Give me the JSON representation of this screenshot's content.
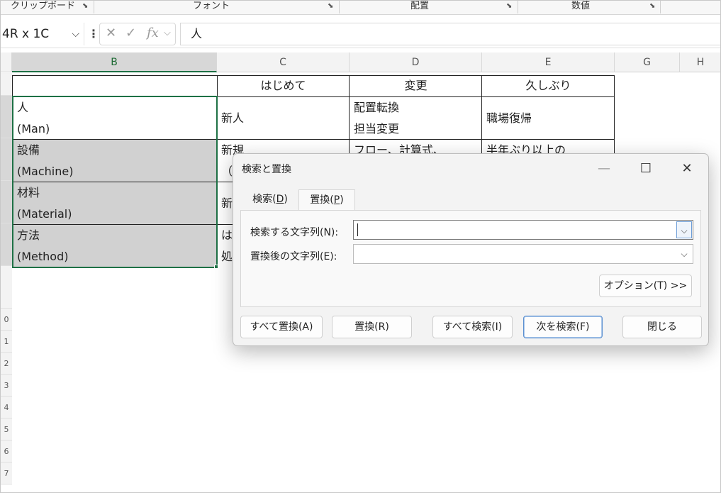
{
  "ribbon": {
    "groups": [
      {
        "label": "クリップボード"
      },
      {
        "label": "フォント"
      },
      {
        "label": "配置"
      },
      {
        "label": "数値"
      }
    ]
  },
  "formula_bar": {
    "name_box": "4R x 1C",
    "cancel_glyph": "✕",
    "enter_glyph": "✓",
    "fx_label": "fx",
    "content": "人"
  },
  "columns": [
    "B",
    "C",
    "D",
    "E",
    "G",
    "H"
  ],
  "row_numbers": [
    "0",
    "1",
    "2",
    "3",
    "4",
    "5",
    "6",
    "7"
  ],
  "table": {
    "headers": [
      "",
      "はじめて",
      "変更",
      "久しぶり"
    ],
    "rows": [
      {
        "b1": "人",
        "b2": "(Man)",
        "c1": "新人",
        "d1": "配置転換",
        "d2": "担当変更",
        "e1": "職場復帰"
      },
      {
        "b1": "設備",
        "b2": "(Machine)",
        "c1": "新規",
        "c2": "（",
        "d1": "フロー、計算式、",
        "e1": "半年ぶり以上の"
      },
      {
        "b1": "材料",
        "b2": "(Material)",
        "c1": "新"
      },
      {
        "b1": "方法",
        "b2": "(Method)",
        "c1": "は",
        "c2": "処"
      }
    ]
  },
  "dialog": {
    "title": "検索と置換",
    "minimize": "—",
    "maximize": "☐",
    "close": "✕",
    "tabs": [
      {
        "label": "検索(D)",
        "pre": "検索(",
        "key": "D",
        "post": ")"
      },
      {
        "label": "置換(P)",
        "pre": "置換(",
        "key": "P",
        "post": ")",
        "active": true
      }
    ],
    "find_label": "検索する文字列(N):",
    "find_value": "",
    "replace_label": "置換後の文字列(E):",
    "replace_value": "",
    "options_button": "オプション(T) >>",
    "buttons": {
      "replace_all": "すべて置換(A)",
      "replace": "置換(R)",
      "find_all": "すべて検索(I)",
      "find_next": "次を検索(F)",
      "close": "閉じる"
    }
  },
  "colors": {
    "selection": "#1e7145",
    "cell_fill": "#d1d1d1",
    "focus_border": "#5a8fd0"
  }
}
